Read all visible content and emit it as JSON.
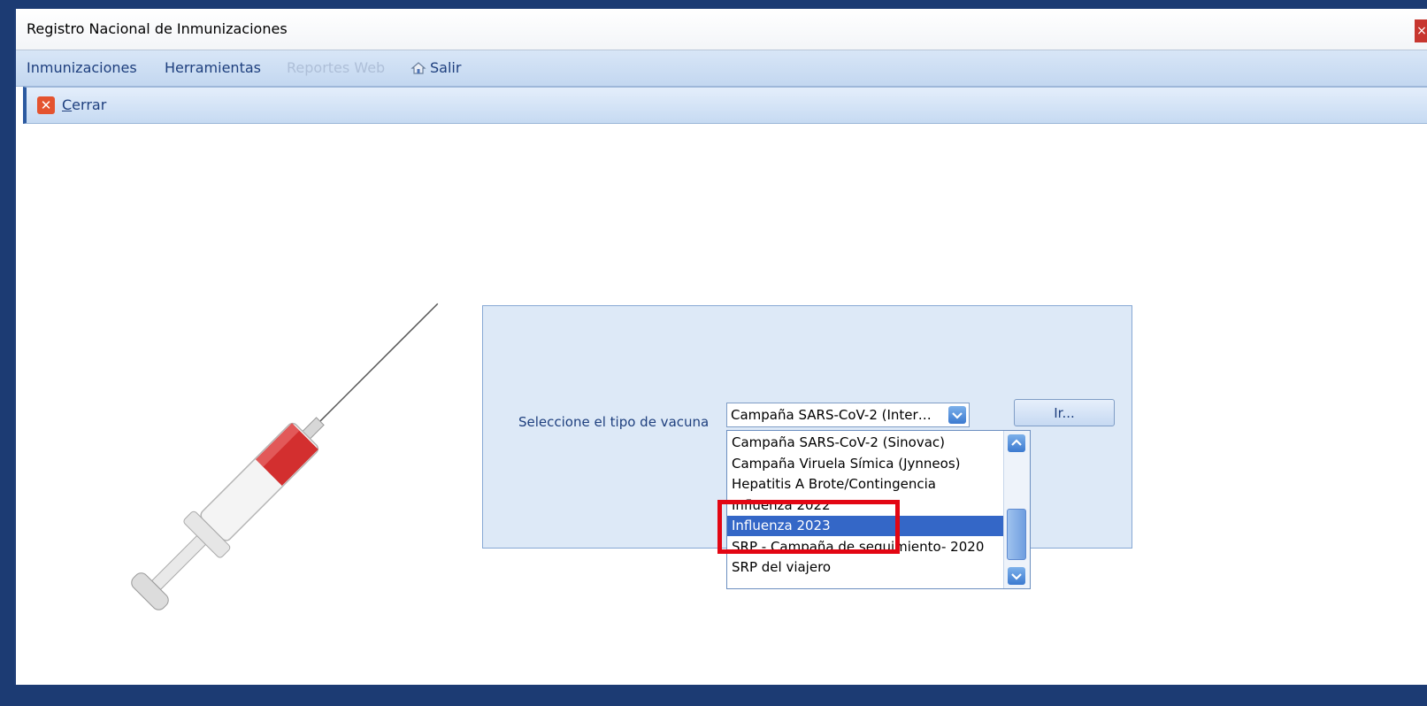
{
  "window": {
    "title": "Registro Nacional de Inmunizaciones",
    "close_glyph": "×"
  },
  "menu": {
    "items": [
      "Inmunizaciones",
      "Herramientas",
      "Reportes Web",
      "Salir"
    ],
    "salir_icon": "house-exit-icon"
  },
  "toolbar": {
    "close_label": "Cerrar",
    "close_icon": "red-x-icon"
  },
  "form": {
    "label": "Seleccione el tipo de vacuna",
    "selected_value": "Campaña SARS-CoV-2 (Inter…",
    "go_button": "Ir..."
  },
  "dropdown": {
    "options": [
      "Campaña SARS-CoV-2 (Sinovac)",
      "Campaña Viruela Símica (Jynneos)",
      "Hepatitis A Brote/Contingencia",
      "Influenza 2022",
      "Influenza 2023",
      "SRP - Campaña de seguimiento- 2020",
      "SRP del viajero"
    ],
    "selected_index": 4
  },
  "colors": {
    "accent": "#3467c7",
    "highlight": "#e30613",
    "menu_text": "#1e3f7e"
  }
}
